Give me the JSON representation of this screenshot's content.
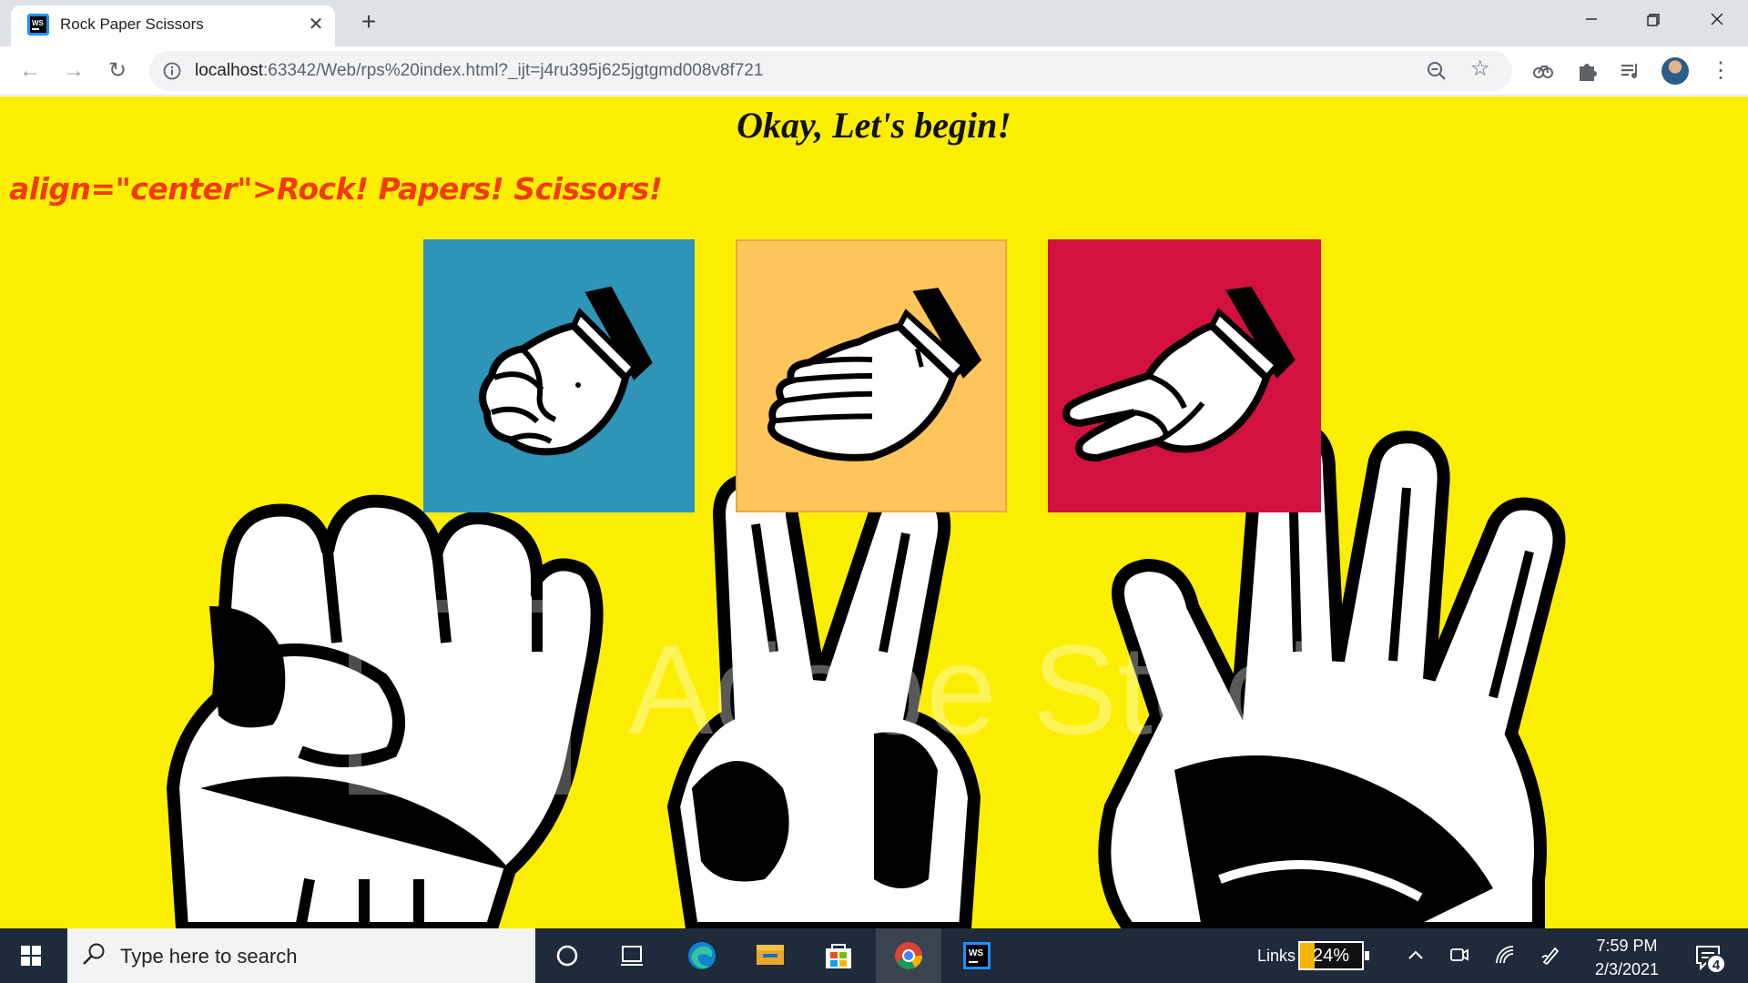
{
  "browser": {
    "tab": {
      "title": "Rock Paper Scissors",
      "close_glyph": "✕",
      "favicon": "webstorm-icon"
    },
    "new_tab_glyph": "+",
    "window_controls": {
      "minimize": "—",
      "restore": "❐",
      "close": "✕"
    },
    "nav": {
      "back": "←",
      "forward": "→",
      "reload": "↻"
    },
    "address": {
      "host": "localhost",
      "rest": ":63342/Web/rps%20index.html?_ijt=j4ru395j625jgtgmd008v8f721"
    },
    "menu_glyph": "⋮"
  },
  "page": {
    "heading": "Okay, Let's begin!",
    "subheading": "align=\"center\">Rock! Papers! Scissors!",
    "watermark": "Adobe Stock",
    "cards": [
      {
        "name": "rock",
        "color": "#2f95b8"
      },
      {
        "name": "paper",
        "color": "#fec55b"
      },
      {
        "name": "scissors",
        "color": "#d2113e"
      }
    ],
    "background_color": "#fcee00"
  },
  "taskbar": {
    "search_placeholder": "Type here to search",
    "links_label": "Links",
    "battery_percent": "24%",
    "battery_level": 0.24,
    "time": "7:59 PM",
    "date": "2/3/2021",
    "notification_count": "4"
  }
}
